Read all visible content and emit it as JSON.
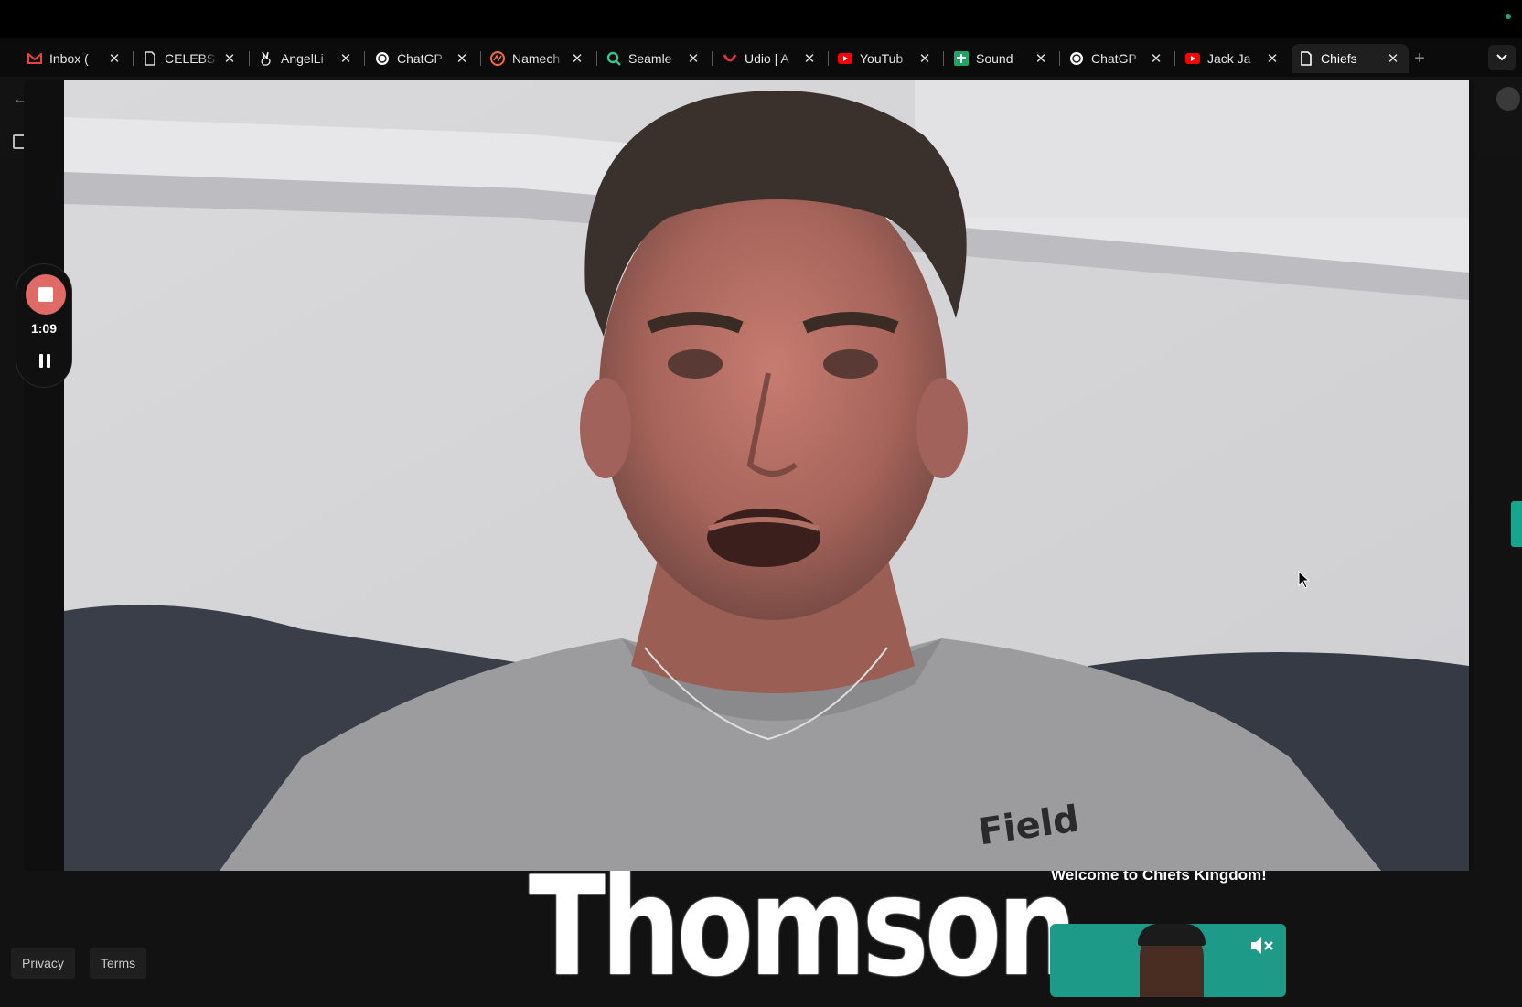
{
  "browser": {
    "tabs": [
      {
        "title": "Inbox (",
        "icon": "gmail-icon",
        "color": "#ea4335"
      },
      {
        "title": "CELEBS",
        "icon": "document-icon",
        "color": "#ffffff"
      },
      {
        "title": "AngelLi",
        "icon": "angellist-icon",
        "color": "#ffffff"
      },
      {
        "title": "ChatGP",
        "icon": "openai-icon",
        "color": "#ffffff"
      },
      {
        "title": "Namech",
        "icon": "namecheap-icon",
        "color": "#f26e3b"
      },
      {
        "title": "Seamle",
        "icon": "seamless-icon",
        "color": "#3cbf88"
      },
      {
        "title": "Udio | A",
        "icon": "udio-icon",
        "color": "#e0333a"
      },
      {
        "title": "YouTub",
        "icon": "youtube-icon",
        "color": "#ff0000"
      },
      {
        "title": "Sound",
        "icon": "sound-icon",
        "color": "#1fa463"
      },
      {
        "title": "ChatGP",
        "icon": "openai-icon",
        "color": "#ffffff"
      },
      {
        "title": "Jack Ja",
        "icon": "youtube-icon",
        "color": "#ff0000"
      },
      {
        "title": "Chiefs",
        "icon": "document-icon",
        "color": "#ffffff",
        "active": true
      }
    ],
    "close_glyph": "✕",
    "new_tab_glyph": "+"
  },
  "recorder": {
    "timer": "1:09",
    "stop_color": "#e06b66"
  },
  "page": {
    "headline": "Thomson",
    "welcome_text": "Welcome to Chiefs Kingdom!",
    "footer": {
      "privacy": "Privacy",
      "terms": "Terms"
    },
    "accent": "#17a58e"
  }
}
